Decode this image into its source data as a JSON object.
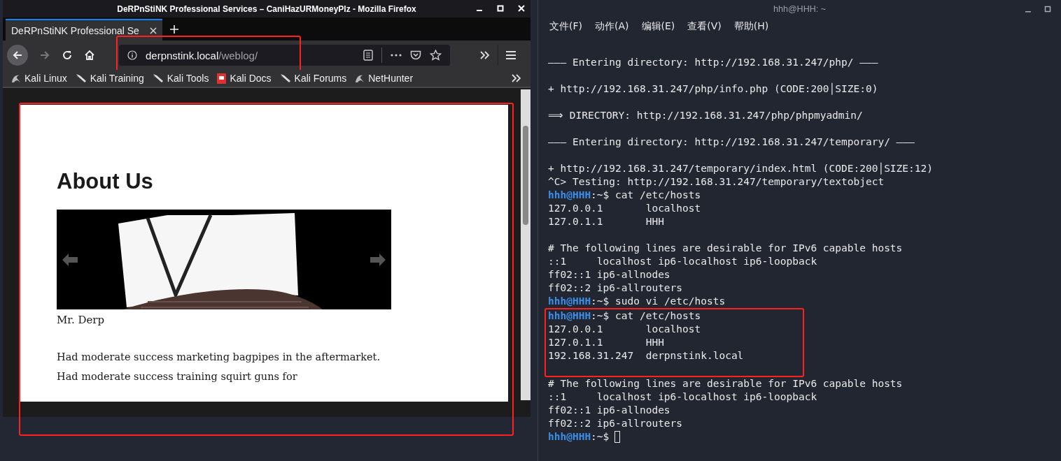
{
  "browser": {
    "window": {
      "title": "DeRPnStiNK Professional Services – CaniHazURMoneyPlz - Mozilla Firefox"
    },
    "tabs": [
      {
        "label": "DeRPnStiNK Professional Se",
        "selected": true
      }
    ],
    "nav": {
      "back_disabled": false,
      "forward_disabled": true
    },
    "address_bar": {
      "host": "derpnstink.local",
      "path": "/weblog/",
      "highlighted": true
    },
    "bookmarks": [
      {
        "label": "Kali Linux",
        "kind": "dragon"
      },
      {
        "label": "Kali Training",
        "kind": "tool"
      },
      {
        "label": "Kali Tools",
        "kind": "tool"
      },
      {
        "label": "Kali Docs",
        "kind": "doc"
      },
      {
        "label": "Kali Forums",
        "kind": "tool"
      },
      {
        "label": "NetHunter",
        "kind": "dragon"
      }
    ],
    "page": {
      "highlighted": true,
      "heading": "About Us",
      "caption": "Mr. Derp",
      "paragraph": "Had moderate success marketing bagpipes in the aftermarket. Had moderate success training squirt guns for"
    }
  },
  "terminal": {
    "window": {
      "title": "hhh@HHH: ~"
    },
    "menu": [
      "文件(F)",
      "动作(A)",
      "编辑(E)",
      "查看(V)",
      "帮助(H)"
    ],
    "blocks": [
      {
        "highlighted": false,
        "lines": [
          {
            "kind": "text",
            "text": "——— Entering directory: http://192.168.31.247/php/ ———"
          },
          {
            "kind": "blank"
          },
          {
            "kind": "text",
            "text": "+ http://192.168.31.247/php/info.php (CODE:200│SIZE:0)"
          },
          {
            "kind": "blank"
          },
          {
            "kind": "text",
            "text": "⟹ DIRECTORY: http://192.168.31.247/php/phpmyadmin/"
          },
          {
            "kind": "blank"
          },
          {
            "kind": "text",
            "text": "——— Entering directory: http://192.168.31.247/temporary/ ———"
          },
          {
            "kind": "blank"
          },
          {
            "kind": "text",
            "text": "+ http://192.168.31.247/temporary/index.html (CODE:200│SIZE:12)"
          },
          {
            "kind": "text",
            "text": "^C> Testing: http://192.168.31.247/temporary/textobject"
          },
          {
            "kind": "prompt",
            "user": "hhh@HHH",
            "path": ":~$",
            "command": "cat /etc/hosts"
          },
          {
            "kind": "text",
            "text": "127.0.0.1       localhost"
          },
          {
            "kind": "text",
            "text": "127.0.1.1       HHH"
          },
          {
            "kind": "blank"
          },
          {
            "kind": "text",
            "text": "# The following lines are desirable for IPv6 capable hosts"
          },
          {
            "kind": "text",
            "text": "::1     localhost ip6-localhost ip6-loopback"
          },
          {
            "kind": "text",
            "text": "ff02::1 ip6-allnodes"
          },
          {
            "kind": "text",
            "text": "ff02::2 ip6-allrouters"
          },
          {
            "kind": "prompt",
            "user": "hhh@HHH",
            "path": ":~$",
            "command": "sudo vi /etc/hosts"
          }
        ]
      },
      {
        "highlighted": true,
        "lines": [
          {
            "kind": "prompt",
            "user": "hhh@HHH",
            "path": ":~$",
            "command": "cat /etc/hosts"
          },
          {
            "kind": "text",
            "text": "127.0.0.1       localhost"
          },
          {
            "kind": "text",
            "text": "127.0.1.1       HHH"
          },
          {
            "kind": "text",
            "text": "192.168.31.247  derpnstink.local"
          },
          {
            "kind": "blank"
          }
        ]
      },
      {
        "highlighted": false,
        "lines": [
          {
            "kind": "text",
            "text": "# The following lines are desirable for IPv6 capable hosts"
          },
          {
            "kind": "text",
            "text": "::1     localhost ip6-localhost ip6-loopback"
          },
          {
            "kind": "text",
            "text": "ff02::1 ip6-allnodes"
          },
          {
            "kind": "text",
            "text": "ff02::2 ip6-allrouters"
          },
          {
            "kind": "prompt",
            "user": "hhh@HHH",
            "path": ":~$",
            "cursor": true
          }
        ]
      }
    ]
  }
}
